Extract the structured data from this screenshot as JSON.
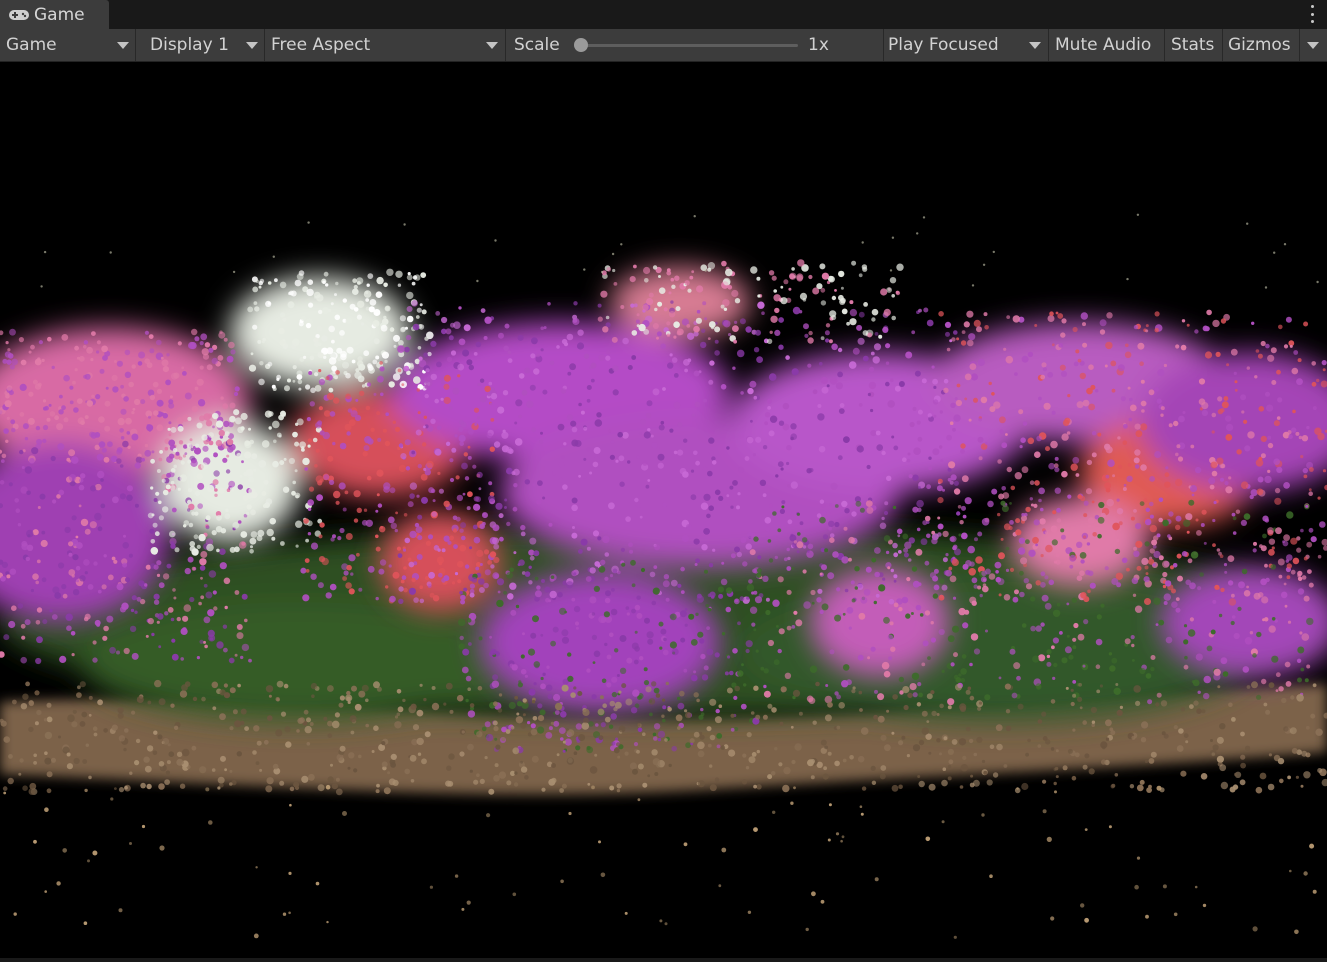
{
  "window": {
    "tab_label": "Game",
    "tab_icon": "gamepad-icon",
    "menu_icon": "kebab-menu-icon"
  },
  "toolbar": {
    "view_dropdown": "Game",
    "display_dropdown": "Display 1",
    "aspect_dropdown": "Free Aspect",
    "scale_label": "Scale",
    "scale_value": "1x",
    "scale_fraction": 0.0,
    "play_mode_dropdown": "Play Focused",
    "mute_audio": "Mute Audio",
    "stats": "Stats",
    "gizmos": "Gizmos"
  },
  "viewport": {
    "background": "#000000",
    "content": "point-cloud-flower-bushes",
    "palette": {
      "magenta": "#b04fc0",
      "violet": "#8a3aa8",
      "pink": "#e07aa8",
      "coral": "#e0545a",
      "white": "#e8ece4",
      "leaf": "#3d6b2a",
      "ground": "#8a7056"
    }
  }
}
